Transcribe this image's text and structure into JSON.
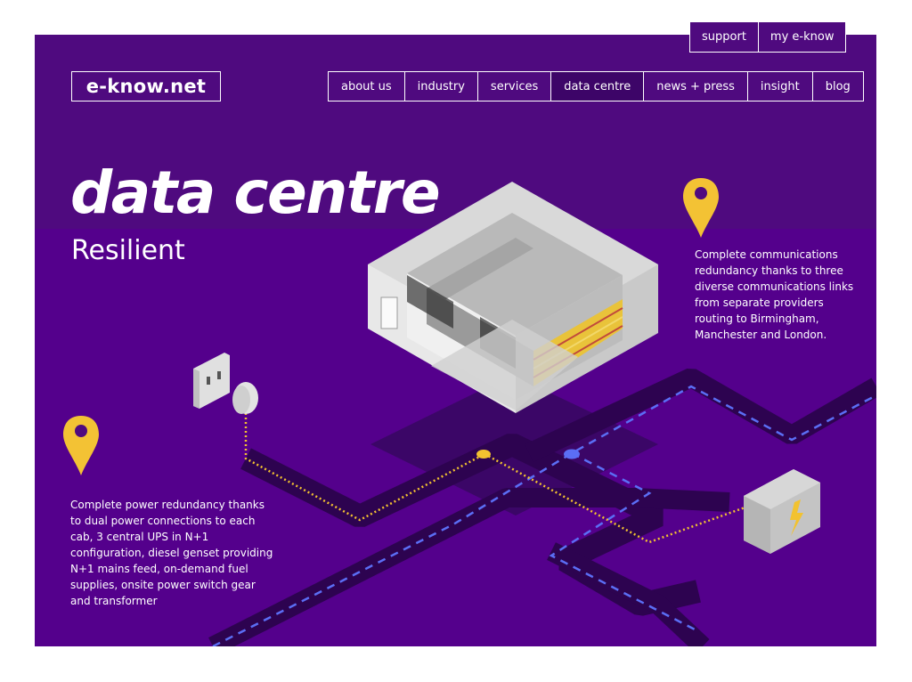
{
  "utility_nav": {
    "support_label": "support",
    "my_eknow_label": "my e-know"
  },
  "brand": {
    "logo_text": "e-know.net"
  },
  "main_nav": {
    "items": [
      {
        "label": "about us"
      },
      {
        "label": "industry"
      },
      {
        "label": "services"
      },
      {
        "label": "data centre",
        "active": true
      },
      {
        "label": "news + press"
      },
      {
        "label": "insight"
      },
      {
        "label": "blog"
      }
    ]
  },
  "hero": {
    "title": "data centre",
    "subtitle": "Resilient"
  },
  "callouts": {
    "communications": "Complete communications redundancy thanks to three diverse communications links from separate providers routing to Birmingham, Manchester and London.",
    "power": "Complete power redundancy thanks to dual power connections to each cab, 3 central UPS in N+1 configuration, diesel genset providing N+1 mains feed, on-demand fuel supplies, onsite power switch gear and transformer"
  },
  "icons": {
    "map_pin": "map-pin-icon",
    "plug_socket": "plug-socket-icon",
    "power_plug": "power-plug-icon",
    "generator": "generator-icon",
    "lightning": "lightning-icon"
  },
  "colors": {
    "background_purple": "#4f0a7f",
    "road_dark": "#2d0350",
    "power_line_yellow": "#f2c230",
    "data_line_blue": "#5b6ef5",
    "pin_yellow": "#f3c234"
  }
}
